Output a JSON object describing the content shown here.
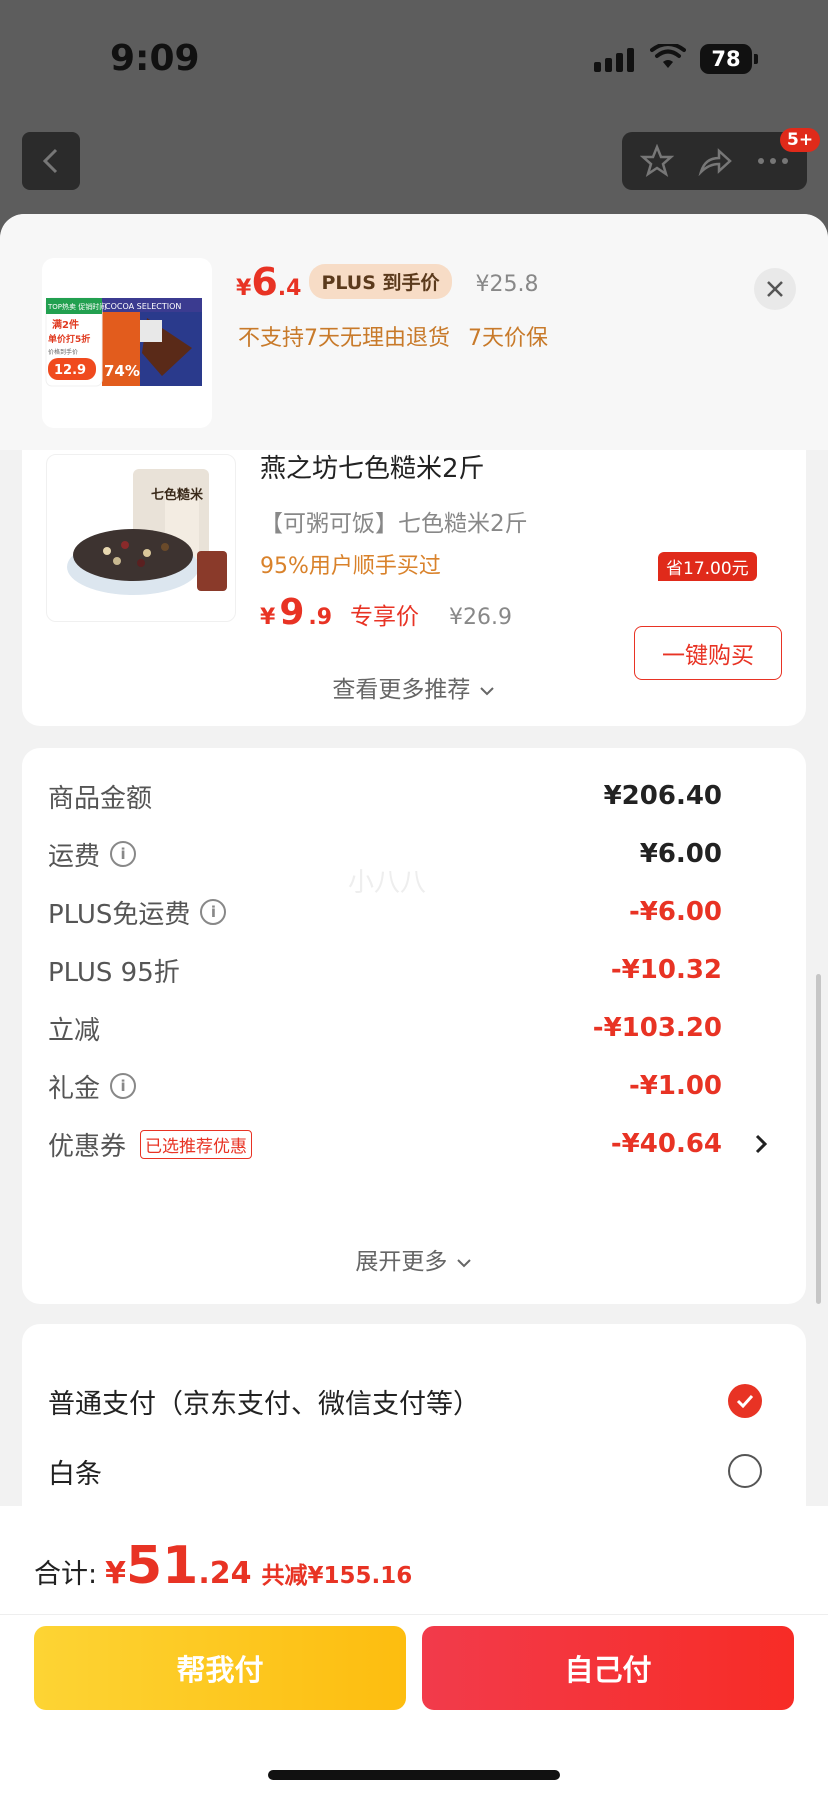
{
  "status": {
    "time": "9:09",
    "battery": "78"
  },
  "nav": {
    "badge": "5+"
  },
  "product": {
    "price_currency": "¥",
    "price_int": "6",
    "price_dec": ".4",
    "plus_label": "PLUS 到手价",
    "original_price": "¥25.8",
    "policy_no_return": "不支持7天无理由退货",
    "policy_price_protect": "7天价保",
    "thumb_promo_top": "TOP热卖 促销时间",
    "thumb_promo_line1": "满2件",
    "thumb_promo_line2": "单价打5折",
    "thumb_promo_price_label": "价格到手价",
    "thumb_promo_price": "12.9",
    "thumb_brand": "COCOA SELECTION",
    "thumb_percent": "74%"
  },
  "recommend": {
    "title": "燕之坊七色糙米2斤",
    "subtitle": "【可粥可饭】七色糙米2斤",
    "bought": "95%用户顺手买过",
    "price_currency": "¥",
    "price_int": "9",
    "price_dec": ".9",
    "price_tag": "专享价",
    "original_price": "¥26.9",
    "save_tag": "省17.00元",
    "quick_buy": "一键购买",
    "see_more": "查看更多推荐",
    "pack_label": "七色糙米"
  },
  "summary": {
    "rows": [
      {
        "label": "商品金额",
        "value": "¥206.40"
      },
      {
        "label": "运费",
        "value": "¥6.00"
      },
      {
        "label": "PLUS免运费",
        "value": "-¥6.00"
      },
      {
        "label": "PLUS 95折",
        "value": "-¥10.32"
      },
      {
        "label": "立减",
        "value": "-¥103.20"
      },
      {
        "label": "礼金",
        "value": "-¥1.00"
      },
      {
        "label": "优惠券",
        "value": "-¥40.64",
        "tag": "已选推荐优惠"
      }
    ],
    "expand": "展开更多",
    "watermark": "小八八"
  },
  "payment": {
    "options": [
      {
        "label": "普通支付（京东支付、微信支付等）",
        "selected": true
      },
      {
        "label": "白条",
        "selected": false
      }
    ]
  },
  "bottom": {
    "total_label": "合计:",
    "currency": "¥",
    "total_int": "51",
    "total_dec": ".24",
    "saved": "共减¥155.16",
    "help_pay": "帮我付",
    "self_pay": "自己付"
  },
  "colors": {
    "accent": "#e83324",
    "help_btn": "#fdc922",
    "self_btn": "#f5343a"
  }
}
